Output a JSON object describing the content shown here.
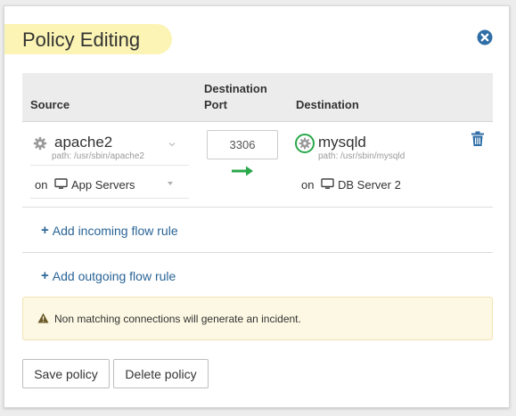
{
  "dialog": {
    "title": "Policy Editing",
    "close_icon": "times-circle-icon"
  },
  "table": {
    "headers": {
      "source": "Source",
      "destination_port": "Destination Port",
      "destination": "Destination"
    },
    "rule": {
      "source": {
        "process": "apache2",
        "path": "path: /usr/sbin/apache2",
        "on_label": "on",
        "host": "App Servers"
      },
      "destination_port": "3306",
      "destination": {
        "process": "mysqld",
        "path": "path: /usr/sbin/mysqld",
        "on_label": "on",
        "host": "DB Server 2"
      }
    }
  },
  "actions": {
    "add_incoming": "Add incoming flow rule",
    "add_outgoing": "Add outgoing flow rule"
  },
  "alert": {
    "text": "Non matching connections will generate an incident."
  },
  "buttons": {
    "save": "Save policy",
    "delete": "Delete policy"
  },
  "colors": {
    "title_highlight": "#fbf4b4",
    "link": "#2a6496",
    "arrow": "#2aa84a",
    "alert_bg": "#fcf8e3",
    "header_bg": "#ececec"
  }
}
